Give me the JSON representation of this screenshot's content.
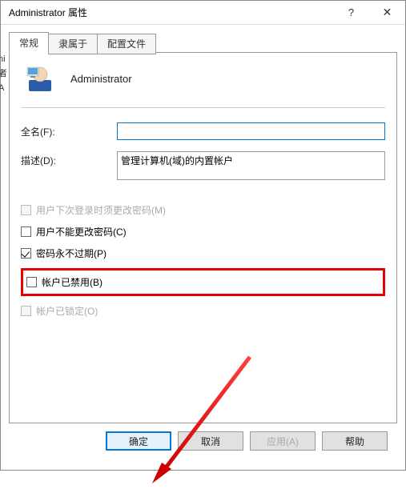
{
  "title": "Administrator 属性",
  "titlebar": {
    "help": "?",
    "close": "✕"
  },
  "tabs": [
    {
      "label": "常规",
      "active": true
    },
    {
      "label": "隶属于",
      "active": false
    },
    {
      "label": "配置文件",
      "active": false
    }
  ],
  "header": {
    "name": "Administrator"
  },
  "fields": {
    "fullname": {
      "label": "全名(F):",
      "value": ""
    },
    "description": {
      "label": "描述(D):",
      "value": "管理计算机(域)的内置帐户"
    }
  },
  "checkboxes": {
    "mustChange": {
      "label": "用户下次登录时须更改密码(M)",
      "checked": false,
      "disabled": true
    },
    "cannotChange": {
      "label": "用户不能更改密码(C)",
      "checked": false,
      "disabled": false
    },
    "neverExpire": {
      "label": "密码永不过期(P)",
      "checked": true,
      "disabled": false
    },
    "disabled": {
      "label": "帐户已禁用(B)",
      "checked": false,
      "disabled": false
    },
    "locked": {
      "label": "帐户已锁定(O)",
      "checked": false,
      "disabled": true
    }
  },
  "buttons": {
    "ok": "确定",
    "cancel": "取消",
    "apply": "应用(A)",
    "help": "帮助"
  },
  "left_fragment": [
    "ni",
    "者",
    "A"
  ]
}
